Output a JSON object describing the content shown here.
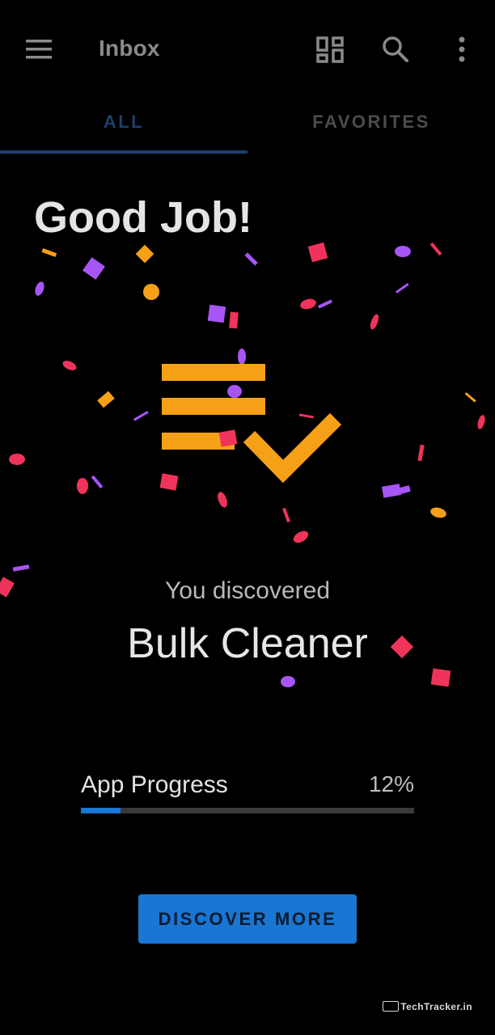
{
  "appbar": {
    "title": "Inbox",
    "icons": [
      "menu-icon",
      "dashboard-icon",
      "search-icon",
      "more-vert-icon"
    ]
  },
  "tabs": [
    {
      "label": "ALL",
      "selected": true
    },
    {
      "label": "FAVORITES",
      "selected": false
    }
  ],
  "celebration": {
    "headline": "Good Job!",
    "intro": "You discovered",
    "feature_name": "Bulk Cleaner",
    "hero_icon": "checklist-icon"
  },
  "progress": {
    "label": "App Progress",
    "value_text": "12%",
    "fraction": 0.12
  },
  "cta": {
    "label": "DISCOVER MORE"
  },
  "watermark": {
    "text": "TechTracker.in"
  },
  "colors": {
    "background": "#000000",
    "accent": "#1976d2",
    "hero": "#f5a017",
    "confetti_pink": "#f0335a",
    "confetti_purple": "#a855f7",
    "confetti_orange": "#f5a017"
  }
}
